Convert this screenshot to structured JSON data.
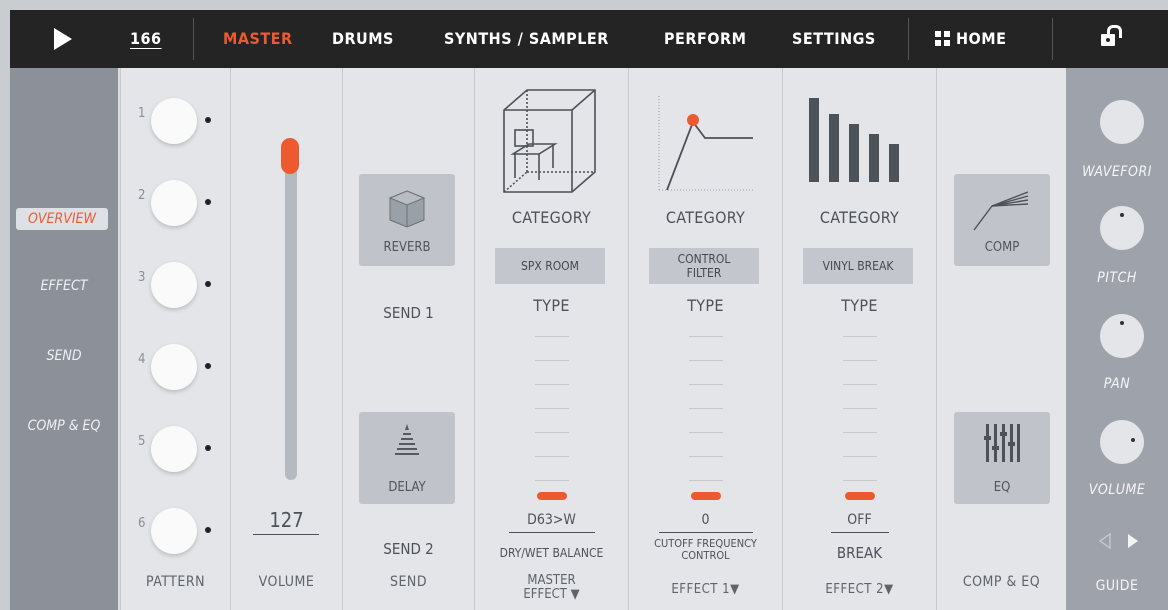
{
  "topbar": {
    "tempo": "166",
    "nav": [
      "MASTER",
      "DRUMS",
      "SYNTHS / SAMPLER",
      "PERFORM",
      "SETTINGS"
    ],
    "home": "HOME",
    "active": "MASTER",
    "accent": "#ee5a2f"
  },
  "sidebar": {
    "items": [
      "OVERVIEW",
      "EFFECT",
      "SEND",
      "COMP & EQ"
    ],
    "active": "OVERVIEW"
  },
  "pattern": {
    "numbers": [
      "1",
      "2",
      "3",
      "4",
      "5",
      "6"
    ],
    "label": "PATTERN"
  },
  "volume": {
    "value": "127",
    "label": "VOLUME"
  },
  "send": {
    "button1": "REVERB",
    "send1": "SEND 1",
    "button2": "DELAY",
    "send2": "SEND 2",
    "label": "SEND"
  },
  "master_effect": {
    "category": "CATEGORY",
    "type_value": "SPX ROOM",
    "type_label": "TYPE",
    "value": "D63>W",
    "param": "DRY/WET BALANCE",
    "label_line1": "MASTER",
    "label_line2": "EFFECT ▼"
  },
  "effect1": {
    "category": "CATEGORY",
    "type_value_line1": "CONTROL",
    "type_value_line2": "FILTER",
    "type_label": "TYPE",
    "value": "0",
    "param_line1": "CUTOFF FREQUENCY",
    "param_line2": "CONTROL",
    "label": "EFFECT 1▼"
  },
  "effect2": {
    "category": "CATEGORY",
    "type_value": "VINYL BREAK",
    "type_label": "TYPE",
    "value": "OFF",
    "param": "BREAK",
    "label": "EFFECT 2▼"
  },
  "compeq": {
    "comp": "COMP",
    "eq": "EQ",
    "label": "COMP & EQ"
  },
  "right": {
    "labels": [
      "WAVEFORI",
      "PITCH",
      "PAN",
      "VOLUME"
    ],
    "guide": "GUIDE"
  }
}
